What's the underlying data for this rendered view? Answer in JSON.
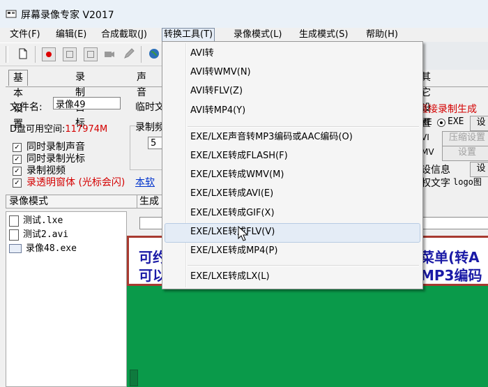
{
  "window": {
    "title": "屏幕录像专家 V2017"
  },
  "menubar": [
    "文件(F)",
    "编辑(E)",
    "合成截取(J)",
    "转换工具(T)",
    "录像模式(L)",
    "生成模式(S)",
    "帮助(H)"
  ],
  "tabs": [
    "基本设置",
    "录制目标",
    "声音",
    "其它设置"
  ],
  "settings": {
    "filename_label": "文件名:",
    "filename_value": "录像49",
    "temp_label": "临时文",
    "disk_label": "D盘可用空间:",
    "disk_value": "117974M",
    "checkboxes": [
      "同时录制声音",
      "同时录制光标",
      "录制视频",
      "录透明窗体 (光标会闪)"
    ],
    "link_text": "本软",
    "frame_label": "录制频",
    "frame_value": "5",
    "direct_gen": "直接录制生成",
    "exe_radio": "EXE",
    "set_btn_1": "设",
    "compress_btn": "压缩设置",
    "settings_btn": "设置",
    "info_label": "设信息",
    "set_btn_2": "设",
    "copyright_label": "权文字",
    "logo_label": "logo图",
    "partial_1": "XE",
    "partial_2": "VI",
    "partial_3": "MV"
  },
  "left_panel": {
    "header": "录像模式",
    "files": [
      {
        "name": "测试.lxe",
        "icon": "document-icon"
      },
      {
        "name": "测试2.avi",
        "icon": "document-icon"
      },
      {
        "name": "录像48.exe",
        "icon": "exe-window-icon"
      }
    ]
  },
  "gen_header": "生成",
  "banner": {
    "line1_left": "可约",
    "line1_right": "菜单(转A",
    "line2_left": "可以",
    "line2_right": "MP3编码"
  },
  "dropdown": {
    "items": [
      "AVI转",
      "AVI转WMV(N)",
      "AVI转FLV(Z)",
      "AVI转MP4(Y)",
      "EXE/LXE声音转MP3编码或AAC编码(O)",
      "EXE/LXE转成FLASH(F)",
      "EXE/LXE转成WMV(M)",
      "EXE/LXE转成AVI(E)",
      "EXE/LXE转成GIF(X)",
      "EXE/LXE转成FLV(V)",
      "EXE/LXE转成MP4(P)",
      "EXE/LXE转成LX(L)"
    ],
    "hover_index": 9
  },
  "colors": {
    "accent_green": "#0a9a4a",
    "banner_blue": "#1a1aa6",
    "red": "#d40000"
  }
}
